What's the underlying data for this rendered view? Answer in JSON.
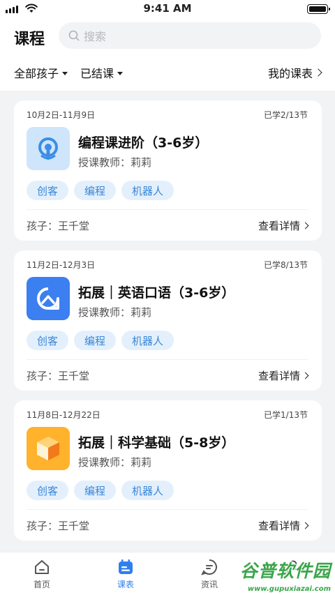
{
  "status_bar": {
    "time": "9:41 AM"
  },
  "header": {
    "title": "课程",
    "search_placeholder": "搜索"
  },
  "filters": {
    "children_label": "全部孩子",
    "status_label": "已结课",
    "my_schedule_label": "我的课表"
  },
  "courses": [
    {
      "date_range": "10月2日-11月9日",
      "progress": "已学2/13节",
      "title": "编程课进阶（3-6岁）",
      "teacher": "授课教师：莉莉",
      "tags": [
        "创客",
        "编程",
        "机器人"
      ],
      "child": "孩子：王千堂",
      "detail_label": "查看详情",
      "icon": "robot-logo-icon",
      "icon_bg": "#cfe5fb"
    },
    {
      "date_range": "11月2日-12月3日",
      "progress": "已学8/13节",
      "title": "拓展｜英语口语（3-6岁）",
      "teacher": "授课教师：莉莉",
      "tags": [
        "创客",
        "编程",
        "机器人"
      ],
      "child": "孩子：王千堂",
      "detail_label": "查看详情",
      "icon": "speech-bubble-icon",
      "icon_bg": "#3b7ff0"
    },
    {
      "date_range": "11月8日-12月22日",
      "progress": "已学1/13节",
      "title": "拓展｜科学基础（5-8岁）",
      "teacher": "授课教师：莉莉",
      "tags": [
        "创客",
        "编程",
        "机器人"
      ],
      "child": "孩子：王千堂",
      "detail_label": "查看详情",
      "icon": "cube-icon",
      "icon_bg": "#ffb22b"
    }
  ],
  "tabbar": {
    "items": [
      {
        "label": "首页",
        "icon": "home-icon",
        "active": false
      },
      {
        "label": "课表",
        "icon": "calendar-icon",
        "active": true
      },
      {
        "label": "资讯",
        "icon": "message-icon",
        "active": false
      }
    ]
  },
  "watermark": {
    "text": "谷普软件园",
    "url": "www.gupuxiazai.com"
  },
  "colors": {
    "accent": "#2f80ed",
    "tag_bg": "#e3f0fc",
    "tag_text": "#3a86d6"
  }
}
